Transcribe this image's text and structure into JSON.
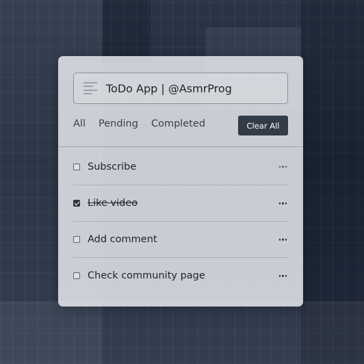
{
  "app": {
    "input_value": "ToDo App | @AsmrProg"
  },
  "filters": [
    {
      "label": "All"
    },
    {
      "label": "Pending"
    },
    {
      "label": "Completed"
    }
  ],
  "clear_button_label": "Clear All",
  "tasks": [
    {
      "label": "Subscribe",
      "completed": false
    },
    {
      "label": "Like video",
      "completed": true
    },
    {
      "label": "Add comment",
      "completed": false
    },
    {
      "label": "Check community page",
      "completed": false
    }
  ],
  "icons": {
    "input_icon": "document-lines-icon",
    "task_menu_icon": "more-horizontal-icon"
  },
  "colors": {
    "button_bg": "#333b46",
    "card_bg": "#eef0f4"
  }
}
